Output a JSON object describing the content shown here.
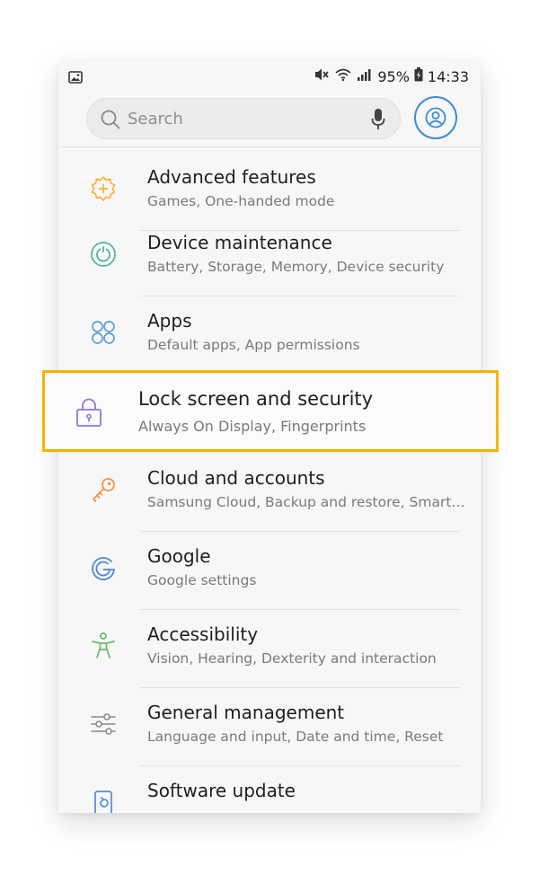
{
  "status_bar": {
    "gallery_icon": "image-icon",
    "battery_percent": "95%",
    "time": "14:33",
    "icons": [
      "mute-icon",
      "wifi-icon",
      "signal-icon",
      "battery-icon"
    ]
  },
  "search": {
    "placeholder": "Search",
    "icons": [
      "search-icon",
      "mic-icon"
    ]
  },
  "profile": {
    "icon": "profile-icon",
    "color": "#3b8cd6"
  },
  "highlight_color": "#f7b500",
  "settings": {
    "items": [
      {
        "title": "Advanced features",
        "subtitle": "Games, One-handed mode",
        "icon": "gear-plus-icon",
        "color": "#f2b43c"
      },
      {
        "title": "Device maintenance",
        "subtitle": "Battery, Storage, Memory, Device security",
        "icon": "maintenance-icon",
        "color": "#4bb3a2"
      },
      {
        "title": "Apps",
        "subtitle": "Default apps, App permissions",
        "icon": "apps-icon",
        "color": "#5a9fd8"
      },
      {
        "title": "Lock screen and security",
        "subtitle": "Always On Display, Fingerprints",
        "icon": "lock-icon",
        "color": "#8c7ad8"
      },
      {
        "title": "Cloud and accounts",
        "subtitle": "Samsung Cloud, Backup and restore, Smart…",
        "icon": "key-icon",
        "color": "#f0934b"
      },
      {
        "title": "Google",
        "subtitle": "Google settings",
        "icon": "google-icon",
        "color": "#4f89d6"
      },
      {
        "title": "Accessibility",
        "subtitle": "Vision, Hearing, Dexterity and interaction",
        "icon": "accessibility-icon",
        "color": "#6cb96c"
      },
      {
        "title": "General management",
        "subtitle": "Language and input, Date and time, Reset",
        "icon": "sliders-icon",
        "color": "#8a8a8a"
      },
      {
        "title": "Software update",
        "subtitle": "",
        "icon": "software-update-icon",
        "color": "#4f89d6"
      }
    ]
  }
}
